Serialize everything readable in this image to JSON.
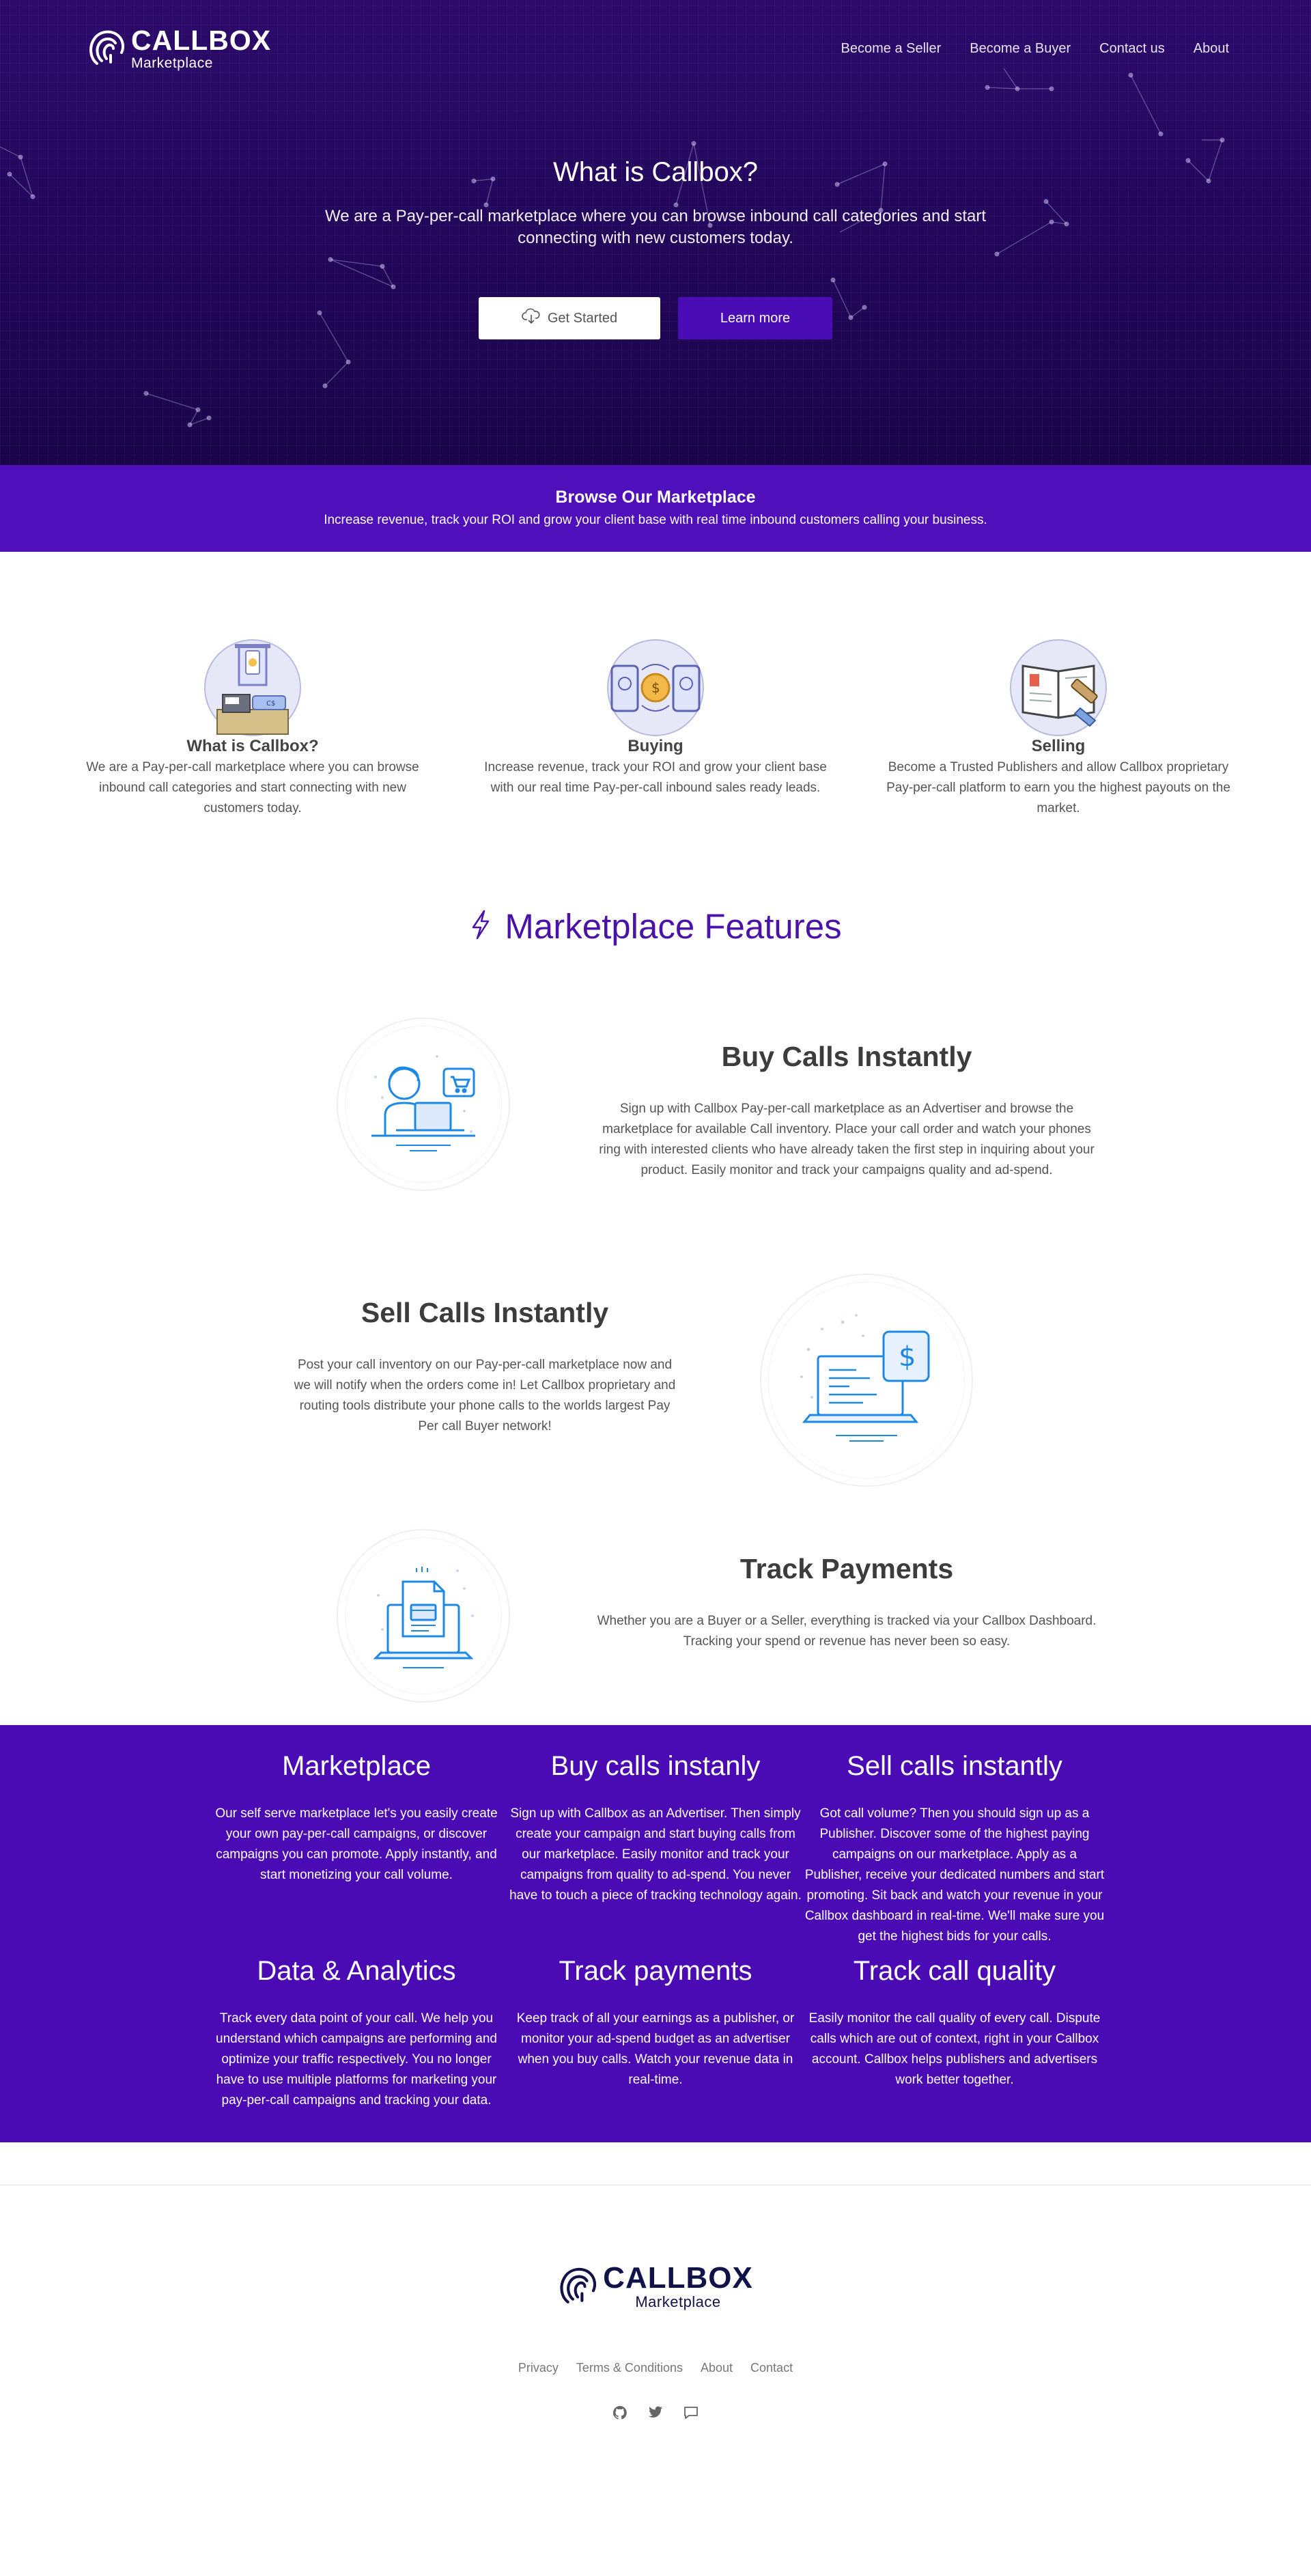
{
  "brand": {
    "name": "CALLBOX",
    "sub": "Marketplace"
  },
  "nav": {
    "items": [
      {
        "label": "Become a Seller"
      },
      {
        "label": "Become a Buyer"
      },
      {
        "label": "Contact us"
      },
      {
        "label": "About"
      }
    ]
  },
  "hero": {
    "title": "What is Callbox?",
    "subtitle": "We are a Pay-per-call marketplace where you can browse inbound call categories and start connecting with new customers today.",
    "primary_button": "Get Started",
    "secondary_button": "Learn more"
  },
  "browse": {
    "title": "Browse Our Marketplace",
    "subtitle": "Increase revenue, track your ROI and grow your client base with real time inbound customers calling your business."
  },
  "cards": [
    {
      "icon": "atm-phone-icon",
      "title": "What is Callbox?",
      "text": "We are a Pay-per-call marketplace where you can browse inbound call categories and start connecting with new customers today."
    },
    {
      "icon": "phone-exchange-icon",
      "title": "Buying",
      "text": "Increase revenue, track your ROI and grow your client base with our real time Pay-per-call inbound sales ready leads."
    },
    {
      "icon": "book-pen-icon",
      "title": "Selling",
      "text": "Become a Trusted Publishers and allow Callbox proprietary Pay-per-call platform to earn you the highest payouts on the market."
    }
  ],
  "features": {
    "title": "Marketplace Features",
    "icon": "lightning-icon",
    "items": [
      {
        "icon": "person-cart-icon",
        "title": "Buy Calls Instantly",
        "text": "Sign up with Callbox Pay-per-call marketplace as an Advertiser and browse the marketplace for available Call inventory. Place your call order and watch your phones ring with interested clients who have already taken the first step in inquiring about your product. Easily monitor and track your campaigns quality and ad-spend."
      },
      {
        "icon": "laptop-dollar-icon",
        "title": "Sell Calls Instantly",
        "text": "Post your call inventory on our Pay-per-call marketplace now and we will notify when the orders come in! Let Callbox proprietary and routing tools distribute your phone calls to the worlds largest Pay Per call Buyer network!"
      },
      {
        "icon": "laptop-document-icon",
        "title": "Track Payments",
        "text": "Whether you are a Buyer or a Seller, everything is tracked via your Callbox Dashboard. Tracking your spend or revenue has never been so easy."
      }
    ]
  },
  "grid": [
    {
      "title": "Marketplace",
      "text": "Our self serve marketplace let's you easily create your own pay-per-call campaigns, or discover campaigns you can promote. Apply instantly, and start monetizing your call volume."
    },
    {
      "title": "Buy calls instanly",
      "text": "Sign up with Callbox as an Advertiser. Then simply create your campaign and start buying calls from our marketplace. Easily monitor and track your campaigns from quality to ad-spend. You never have to touch a piece of tracking technology again."
    },
    {
      "title": "Sell calls instantly",
      "text": "Got call volume? Then you should sign up as a Publisher. Discover some of the highest paying campaigns on our marketplace. Apply as a Publisher, receive your dedicated numbers and start promoting. Sit back and watch your revenue in your Callbox dashboard in real-time. We'll make sure you get the highest bids for your calls."
    },
    {
      "title": "Data & Analytics",
      "text": "Track every data point of your call. We help you understand which campaigns are performing and optimize your traffic respectively. You no longer have to use multiple platforms for marketing your pay-per-call campaigns and tracking your data."
    },
    {
      "title": "Track payments",
      "text": "Keep track of all your earnings as a publisher, or monitor your ad-spend budget as an advertiser when you buy calls. Watch your revenue data in real-time."
    },
    {
      "title": "Track call quality",
      "text": "Easily monitor the call quality of every call. Dispute calls which are out of context, right in your Callbox account. Callbox helps publishers and advertisers work better together."
    }
  ],
  "footer": {
    "links": [
      {
        "label": "Privacy"
      },
      {
        "label": "Terms & Conditions"
      },
      {
        "label": "About"
      },
      {
        "label": "Contact"
      }
    ],
    "social": [
      "github-icon",
      "twitter-icon",
      "chat-icon"
    ]
  },
  "colors": {
    "hero_bg": "#23075c",
    "brand_purple": "#4a0bb4",
    "features_title": "#4a12a8",
    "icon_blue": "#1e88e5"
  }
}
